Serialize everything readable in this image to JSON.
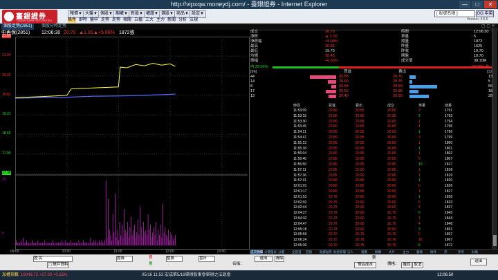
{
  "window": {
    "title": "http://vipxqw.moneydj.com/ - 臺銀證券 - Internet Explorer",
    "min": "—",
    "max": "□",
    "close": "✕"
  },
  "logo": {
    "name": "臺銀證券",
    "en": "TAIWAN BANK SECURITIES"
  },
  "menu": [
    "報價▼",
    "大盤▼",
    "個股▼",
    "期權▼",
    "新股▼",
    "權證▼",
    "選股▼",
    "商品▼",
    "設定▼"
  ],
  "submenu": [
    "條件",
    "即時",
    "盤中",
    "走勢",
    "走勢",
    "相關",
    "五檔",
    "三大",
    "主力",
    "新聞",
    "分析",
    "法規"
  ],
  "search": {
    "placeholder": "[ 股號名稱 ]",
    "go": "GO 中英",
    "version": "Version: 4.5.6"
  },
  "toolbar": {
    "left": "個股走勢(2851)",
    "tab": "個股分時走勢",
    "right_icons": "▢ ▢ ✕"
  },
  "quote": {
    "name": "中再保(2851)",
    "time": "12:06:30",
    "price": "20.70",
    "arrow": "▲",
    "chg": "1.00",
    "pct": "+5.08%",
    "vol": "1872張"
  },
  "chart_data": {
    "type": "line",
    "title": "",
    "xlabel": "",
    "ylabel": "",
    "y_ticks": [
      "21.65",
      "21.04",
      "20.43",
      "19.82",
      "19.21",
      "18.60",
      "17.99",
      "17.38"
    ],
    "x_ticks": [
      "09:00",
      "10:00",
      "11:00",
      "12:00",
      "13:00"
    ],
    "ylim": [
      17.38,
      21.65
    ],
    "ref": 19.7,
    "price": {
      "x": [
        "09:00",
        "09:30",
        "10:00",
        "10:05",
        "10:30",
        "11:00",
        "11:02",
        "11:10",
        "11:20",
        "11:30",
        "11:40",
        "11:50",
        "12:00",
        "12:06"
      ],
      "y": [
        19.75,
        19.78,
        19.82,
        20.02,
        20.05,
        20.08,
        20.7,
        20.68,
        20.78,
        20.74,
        20.82,
        20.76,
        20.8,
        20.72
      ]
    },
    "avg": {
      "x": [
        "09:00",
        "10:00",
        "10:30",
        "11:00",
        "11:30",
        "12:00",
        "12:06"
      ],
      "y": [
        19.73,
        19.76,
        19.79,
        19.8,
        19.82,
        19.85,
        19.86
      ]
    },
    "vol_ticks": [
      "25",
      "5"
    ],
    "vol_bars": [
      1,
      2,
      1,
      1,
      1,
      2,
      1,
      3,
      1,
      1,
      2,
      1,
      1,
      1,
      1,
      2,
      1,
      1,
      1,
      1,
      2,
      1,
      1,
      1,
      1,
      1,
      2,
      1,
      1,
      1,
      1,
      1,
      1,
      2,
      1,
      1,
      1,
      1,
      1,
      1,
      1,
      2,
      1,
      1,
      2,
      1,
      1,
      1,
      1,
      2,
      1,
      1,
      1,
      1,
      1,
      1,
      2,
      1,
      1,
      1,
      2,
      1,
      1,
      1,
      1,
      1,
      3,
      1,
      1,
      2,
      1,
      2,
      1,
      1,
      2,
      1,
      2,
      1,
      1,
      2,
      25,
      3,
      18,
      6,
      4,
      2,
      12,
      5,
      20,
      3,
      6,
      2,
      9,
      4,
      8,
      3,
      14,
      6,
      5,
      9,
      3,
      7,
      11,
      4,
      6,
      8,
      3,
      5,
      10,
      4,
      15,
      7,
      3,
      9,
      5,
      6,
      4,
      12,
      6,
      8,
      3,
      5,
      7,
      4,
      9,
      2,
      6,
      4,
      8,
      3,
      16,
      5,
      7,
      4,
      3,
      6,
      2,
      5,
      4,
      2,
      3,
      4
    ]
  },
  "summary": {
    "rows": [
      {
        "l": "成交",
        "v": "20.70",
        "l2": "時間",
        "v2": "12:06:30"
      },
      {
        "l": "漲跌",
        "v": "▲ 1.00",
        "l2": "單量",
        "v2": "5"
      },
      {
        "l": "漲跌幅",
        "v": "+5.08%",
        "l2": "總量",
        "v2": "1872"
      },
      {
        "l": "最高",
        "v": "20.85",
        "l2": "昨量",
        "v2": "1625"
      },
      {
        "l": "最低",
        "v": "19.70",
        "l2": "昨收",
        "v2": "19.70"
      },
      {
        "l": "均價",
        "v": "20.45",
        "l2": "開盤",
        "v2": "19.70"
      },
      {
        "l": "振幅",
        "v": "+6.35%",
        "l2": "成交值",
        "v2": "38.10M"
      }
    ],
    "bar_left": "內 29.92%",
    "bar_right": "70.08% 外",
    "bar_left_pct": 29.92
  },
  "book": {
    "count_left": "[96]",
    "count_right": "[125]",
    "hdr_bid": "買進",
    "hdr_ask": "賣出",
    "rows": [
      {
        "bq": "44",
        "bp": "20.55",
        "ap": "20.75",
        "aq": "13"
      },
      {
        "bq": "14",
        "bp": "20.60",
        "ap": "20.75",
        "aq": "5"
      },
      {
        "bq": "8",
        "bp": "20.55",
        "ap": "20.80",
        "aq": "55"
      },
      {
        "bq": "17",
        "bp": "20.50",
        "ap": "20.85",
        "aq": "18"
      },
      {
        "bq": "13",
        "bp": "20.45",
        "ap": "20.90",
        "aq": "39"
      }
    ]
  },
  "ticks": {
    "headers": [
      "時間",
      "買進",
      "賣出",
      "成交",
      "單量",
      "總量"
    ],
    "rows": [
      [
        "11:53:09",
        "20.80",
        "20.85",
        "20.80",
        "3",
        "1791"
      ],
      [
        "11:53:15",
        "20.80",
        "20.85",
        "20.85",
        "2",
        "1793"
      ],
      [
        "11:53:30",
        "20.80",
        "20.85",
        "20.85",
        "1",
        "1794"
      ],
      [
        "11:53:45",
        "20.80",
        "20.85",
        "20.80",
        "1",
        "1795"
      ],
      [
        "11:54:11",
        "20.80",
        "20.85",
        "20.80",
        "1",
        "1796"
      ],
      [
        "11:54:47",
        "20.80",
        "20.85",
        "20.80",
        "3",
        "1799"
      ],
      [
        "11:55:13",
        "20.80",
        "20.85",
        "20.80",
        "1",
        "1800"
      ],
      [
        "11:55:18",
        "20.80",
        "20.85",
        "20.85",
        "1",
        "1801"
      ],
      [
        "11:56:04",
        "20.80",
        "20.85",
        "20.85",
        "1",
        "1802"
      ],
      [
        "11:56:40",
        "20.80",
        "20.85",
        "20.85",
        "5",
        "1807"
      ],
      [
        "11:56:50",
        "20.80",
        "20.85",
        "20.85",
        "10",
        "1817"
      ],
      [
        "11:57:11",
        "20.85",
        "20.90",
        "20.85",
        "1",
        "1818"
      ],
      [
        "11:57:36",
        "20.85",
        "20.90",
        "20.85",
        "1",
        "1819"
      ],
      [
        "11:57:41",
        "20.80",
        "20.85",
        "20.85",
        "1",
        "1820"
      ],
      [
        "12:01:01",
        "20.80",
        "20.85",
        "20.80",
        "6",
        "1826"
      ],
      [
        "12:01:17",
        "20.80",
        "20.85",
        "20.80",
        "1",
        "1827"
      ],
      [
        "12:01:53",
        "20.75",
        "20.80",
        "20.80",
        "1",
        "1828"
      ],
      [
        "12:02:03",
        "20.75",
        "20.80",
        "20.80",
        "5",
        "1833"
      ],
      [
        "12:02:44",
        "20.75",
        "20.80",
        "20.80",
        "4",
        "1837"
      ],
      [
        "12:04:27",
        "20.75",
        "20.80",
        "20.75",
        "6",
        "1843"
      ],
      [
        "12:04:32",
        "20.75",
        "20.80",
        "20.75",
        "1",
        "1844"
      ],
      [
        "12:04:47",
        "20.75",
        "20.80",
        "20.75",
        "4",
        "1848"
      ],
      [
        "12:05:18",
        "20.75",
        "20.80",
        "20.80",
        "3",
        "1851"
      ],
      [
        "12:05:59",
        "20.70",
        "20.75",
        "20.70",
        "6",
        "1857"
      ],
      [
        "12:06:24",
        "20.70",
        "20.75",
        "20.70",
        "10",
        "1867"
      ],
      [
        "12:06:30",
        "20.70",
        "20.75",
        "20.70",
        "5",
        "1872"
      ]
    ]
  },
  "bottom_tabs": [
    "成交明細",
    "分價量表",
    "分價",
    "全部選",
    "回報",
    "融資融券",
    "財經新聞",
    "法人",
    "買賣",
    "期權",
    "大戶",
    "主力",
    "籌碼",
    "條件",
    "券",
    "參考",
    "財報"
  ],
  "order": {
    "acct": "證 民",
    "acct_btn": "▢ 帳戶資料",
    "type": "證券",
    "buy": "買",
    "sell": "賣",
    "price_mode": "整股",
    "period": "當日",
    "stock_label": "名稱：",
    "confirm": "送出",
    "clear": "清除",
    "qty": "張",
    "price_label": "預估成本",
    "p2": "價格：",
    "btn_a": "確認",
    "btn_b": "取消",
    "send": "送出"
  },
  "status": {
    "index": "加權指數",
    "index_val": "10049.72 +27.00 +0.15%",
    "ticker": "05/16 11:53 宏成第5/18舉辦股東會舉辦之法說會",
    "time": "12:06:50"
  },
  "colors": {
    "up": "#ff3030",
    "down": "#20e020",
    "flat": "#ffff00",
    "cyan": "#00e5ff"
  }
}
